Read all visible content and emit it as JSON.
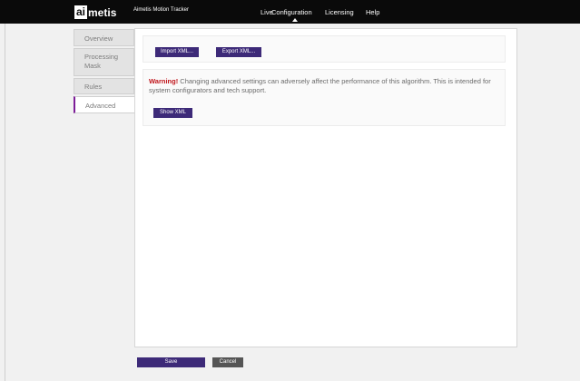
{
  "header": {
    "logo_ai": "ai",
    "logo_rest": "metis",
    "app_title": "Aimetis Motion Tracker",
    "nav": [
      "Live",
      "Configuration",
      "Licensing",
      "Help"
    ],
    "active_nav": "Configuration"
  },
  "tabs": [
    {
      "label": "Overview"
    },
    {
      "label": "Processing Mask"
    },
    {
      "label": "Rules"
    },
    {
      "label": "Advanced"
    }
  ],
  "active_tab": "Advanced",
  "main": {
    "import_label": "Import XML...",
    "export_label": "Export XML...",
    "warning_prefix": "Warning!",
    "warning_text": " Changing advanced settings can adversely affect the performance of this algorithm. This is intended for system configurators and tech support.",
    "show_xml_label": "Show XML"
  },
  "footer": {
    "save_label": "Save",
    "cancel_label": "Cancel"
  },
  "colors": {
    "topbar": "#0a0a0a",
    "primary_button": "#3d2a78",
    "cancel_button": "#555555",
    "warning": "#c0151b",
    "active_tab_accent": "#7d1d98"
  }
}
